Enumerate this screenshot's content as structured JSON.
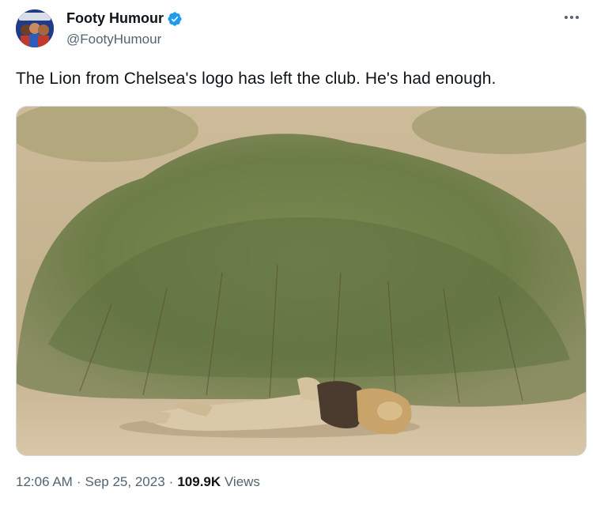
{
  "author": {
    "display_name": "Footy Humour",
    "handle": "@FootyHumour",
    "verified": true,
    "avatar_icon": "footy-humour-avatar",
    "verified_icon": "verified-badge-icon",
    "verified_color": "#1d9bf0"
  },
  "tweet": {
    "text": "The Lion from Chelsea's logo has left the club. He's had enough.",
    "media_icon": "photo-lion-under-bush"
  },
  "meta": {
    "time": "12:06 AM",
    "separator": "·",
    "date": "Sep 25, 2023",
    "views_count": "109.9K",
    "views_label": "Views"
  },
  "menu": {
    "icon": "more-options-icon"
  },
  "colors": {
    "text": "#0f1419",
    "secondary": "#536471",
    "border": "#cfd9de"
  }
}
